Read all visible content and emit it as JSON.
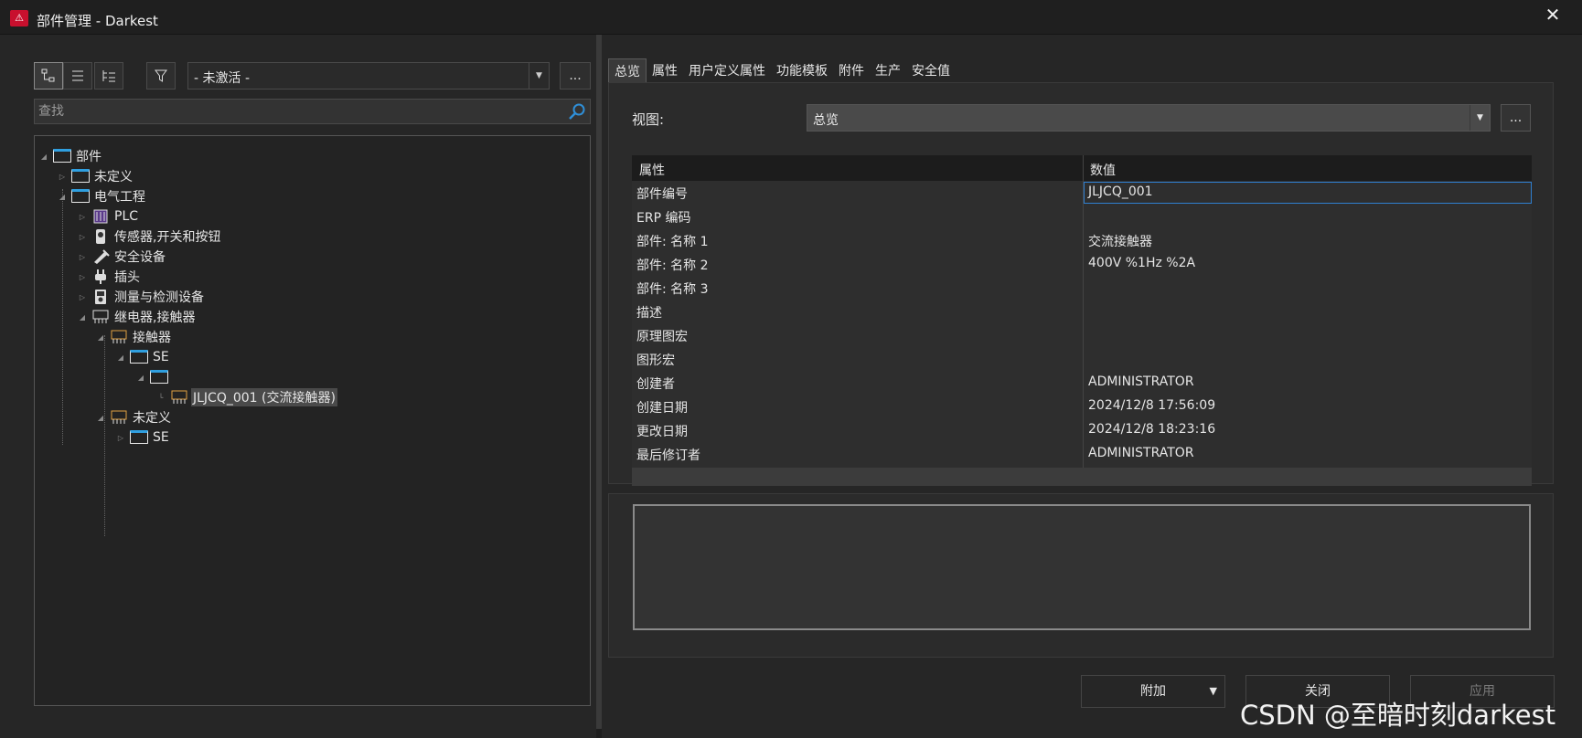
{
  "window": {
    "title": "部件管理 - Darkest",
    "close_glyph": "✕",
    "app_icon_glyph": "⚠"
  },
  "toolbar": {
    "view_tree_icon": "tree-view-icon",
    "view_list_icon": "list-view-icon",
    "view_hier_icon": "hierarchy-view-icon",
    "filter_icon": "filter-icon",
    "filter_value": "- 未激活 -",
    "combo_arrow": "▼",
    "more_label": "..."
  },
  "search": {
    "placeholder": "查找"
  },
  "tree": {
    "root": "部件",
    "undefined1": "未定义",
    "electrical": "电气工程",
    "plc": "PLC",
    "sensors": "传感器,开关和按钮",
    "safety": "安全设备",
    "plug": "插头",
    "measure": "测量与检测设备",
    "relay": "继电器,接触器",
    "contactor": "接触器",
    "se1": "SE",
    "item": "JLJCQ_001 (交流接触器)",
    "undefined2": "未定义",
    "se2": "SE"
  },
  "tabs": [
    "总览",
    "属性",
    "用户定义属性",
    "功能模板",
    "附件",
    "生产",
    "安全值"
  ],
  "view": {
    "label": "视图:",
    "value": "总览",
    "more_label": "..."
  },
  "grid": {
    "col_property": "属性",
    "col_value": "数值",
    "rows": [
      {
        "name": "部件编号",
        "value": "JLJCQ_001"
      },
      {
        "name": "ERP 编码",
        "value": ""
      },
      {
        "name": "部件: 名称 1",
        "value": "交流接触器"
      },
      {
        "name": "部件: 名称 2",
        "value": "400V %1Hz %2A"
      },
      {
        "name": "部件: 名称 3",
        "value": ""
      },
      {
        "name": "描述",
        "value": ""
      },
      {
        "name": "原理图宏",
        "value": ""
      },
      {
        "name": "图形宏",
        "value": ""
      },
      {
        "name": "创建者",
        "value": "ADMINISTRATOR"
      },
      {
        "name": "创建日期",
        "value": "2024/12/8 17:56:09"
      },
      {
        "name": "更改日期",
        "value": "2024/12/8 18:23:16"
      },
      {
        "name": "最后修订者",
        "value": "ADMINISTRATOR"
      }
    ]
  },
  "buttons": {
    "extra": "附加",
    "close": "关闭",
    "apply": "应用"
  },
  "watermark": "CSDN @至暗时刻darkest"
}
